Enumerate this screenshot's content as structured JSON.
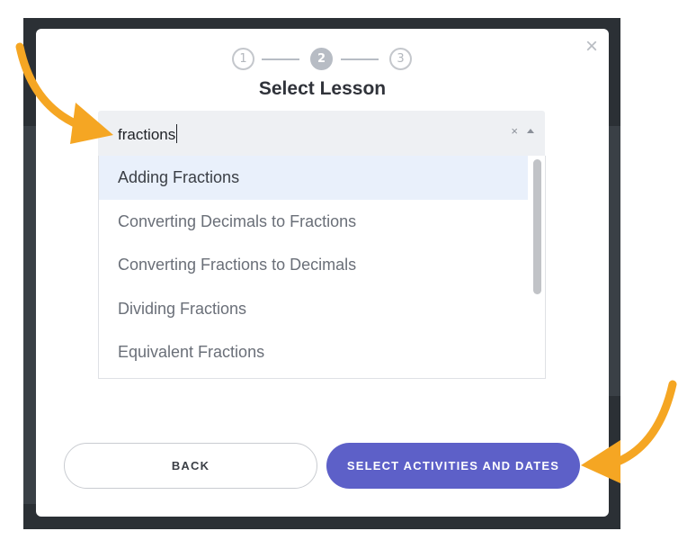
{
  "stepper": {
    "steps": [
      "1",
      "2",
      "3"
    ],
    "current": 2
  },
  "modal": {
    "title": "Select Lesson",
    "close_glyph": "×"
  },
  "search": {
    "value": "fractions",
    "clear_glyph": "×"
  },
  "options": [
    {
      "label": "Adding Fractions",
      "highlighted": true
    },
    {
      "label": "Converting Decimals to Fractions",
      "highlighted": false
    },
    {
      "label": "Converting Fractions to Decimals",
      "highlighted": false
    },
    {
      "label": "Dividing Fractions",
      "highlighted": false
    },
    {
      "label": "Equivalent Fractions",
      "highlighted": false
    }
  ],
  "buttons": {
    "back": "BACK",
    "next": "SELECT ACTIVITIES AND DATES"
  },
  "colors": {
    "primary": "#5d60c8",
    "annotation_arrow": "#f5a623",
    "highlight": "#e9f0fb"
  }
}
